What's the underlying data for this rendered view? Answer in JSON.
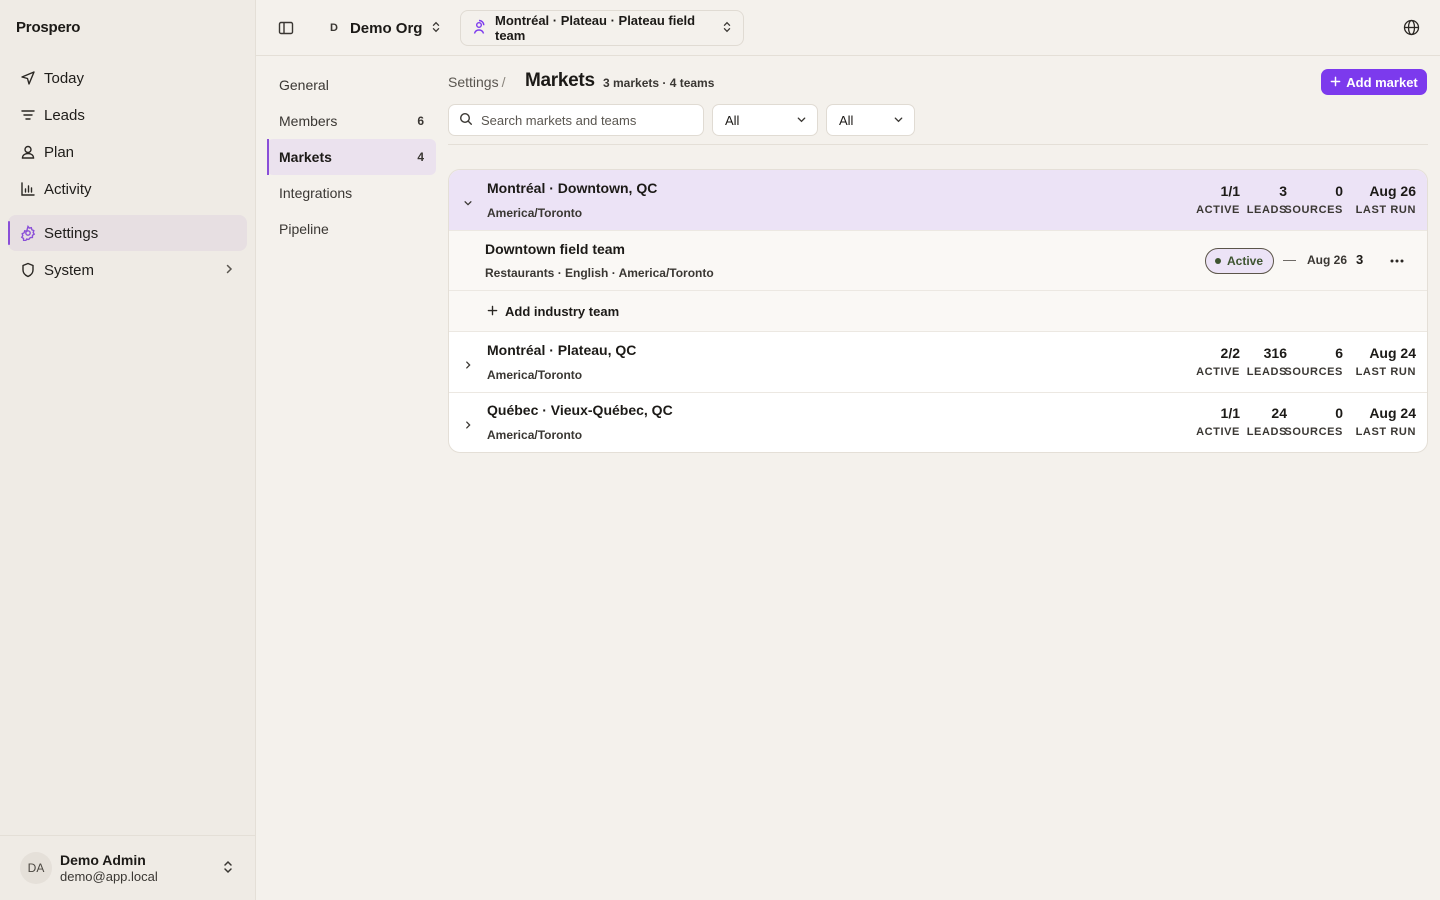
{
  "app": {
    "brand": "Prospero"
  },
  "sidebar": {
    "items": [
      {
        "label": "Today",
        "icon": "send-icon"
      },
      {
        "label": "Leads",
        "icon": "filter-icon"
      },
      {
        "label": "Plan",
        "icon": "user-icon"
      },
      {
        "label": "Activity",
        "icon": "bar-chart-icon"
      },
      {
        "label": "Settings",
        "icon": "gear-icon",
        "active": true
      },
      {
        "label": "System",
        "icon": "shield-icon"
      }
    ],
    "user": {
      "initials": "DA",
      "name": "Demo Admin",
      "email": "demo@app.local"
    }
  },
  "topbar": {
    "org_initial": "D",
    "org_name": "Demo Org",
    "team_switcher": "Montréal · Plateau · Plateau field team"
  },
  "settings_nav": {
    "items": [
      {
        "label": "General",
        "count": ""
      },
      {
        "label": "Members",
        "count": "6"
      },
      {
        "label": "Markets",
        "count": "4",
        "active": true
      },
      {
        "label": "Integrations",
        "count": ""
      },
      {
        "label": "Pipeline",
        "count": ""
      }
    ]
  },
  "header": {
    "breadcrumb": "Settings",
    "breadcrumb_sep": "/",
    "title": "Markets",
    "meta": "3 markets · 4 teams",
    "add_button": "Add market"
  },
  "filters": {
    "search_placeholder": "Search markets and teams",
    "select1": "All",
    "select2": "All"
  },
  "stat_labels": {
    "active": "ACTIVE",
    "leads": "LEADS",
    "sources": "SOURCES",
    "last_run": "LAST RUN"
  },
  "markets": [
    {
      "name": "Montréal · Downtown, QC",
      "tz": "America/Toronto",
      "active": "1/1",
      "leads": "3",
      "sources": "0",
      "last_run": "Aug 26",
      "expanded": true
    },
    {
      "name": "Montréal · Plateau, QC",
      "tz": "America/Toronto",
      "active": "2/2",
      "leads": "316",
      "sources": "6",
      "last_run": "Aug 24",
      "expanded": false
    },
    {
      "name": "Québec · Vieux-Québec, QC",
      "tz": "America/Toronto",
      "active": "1/1",
      "leads": "24",
      "sources": "0",
      "last_run": "Aug 24",
      "expanded": false
    }
  ],
  "team": {
    "name": "Downtown field team",
    "meta": "Restaurants · English · America/Toronto",
    "status": "Active",
    "dash": "—",
    "date": "Aug 26",
    "count": "3"
  },
  "add_team_label": "Add industry team",
  "colors": {
    "accent": "#7c3aed",
    "expanded_row": "#ece3f6",
    "status_green": "#3e5430"
  }
}
